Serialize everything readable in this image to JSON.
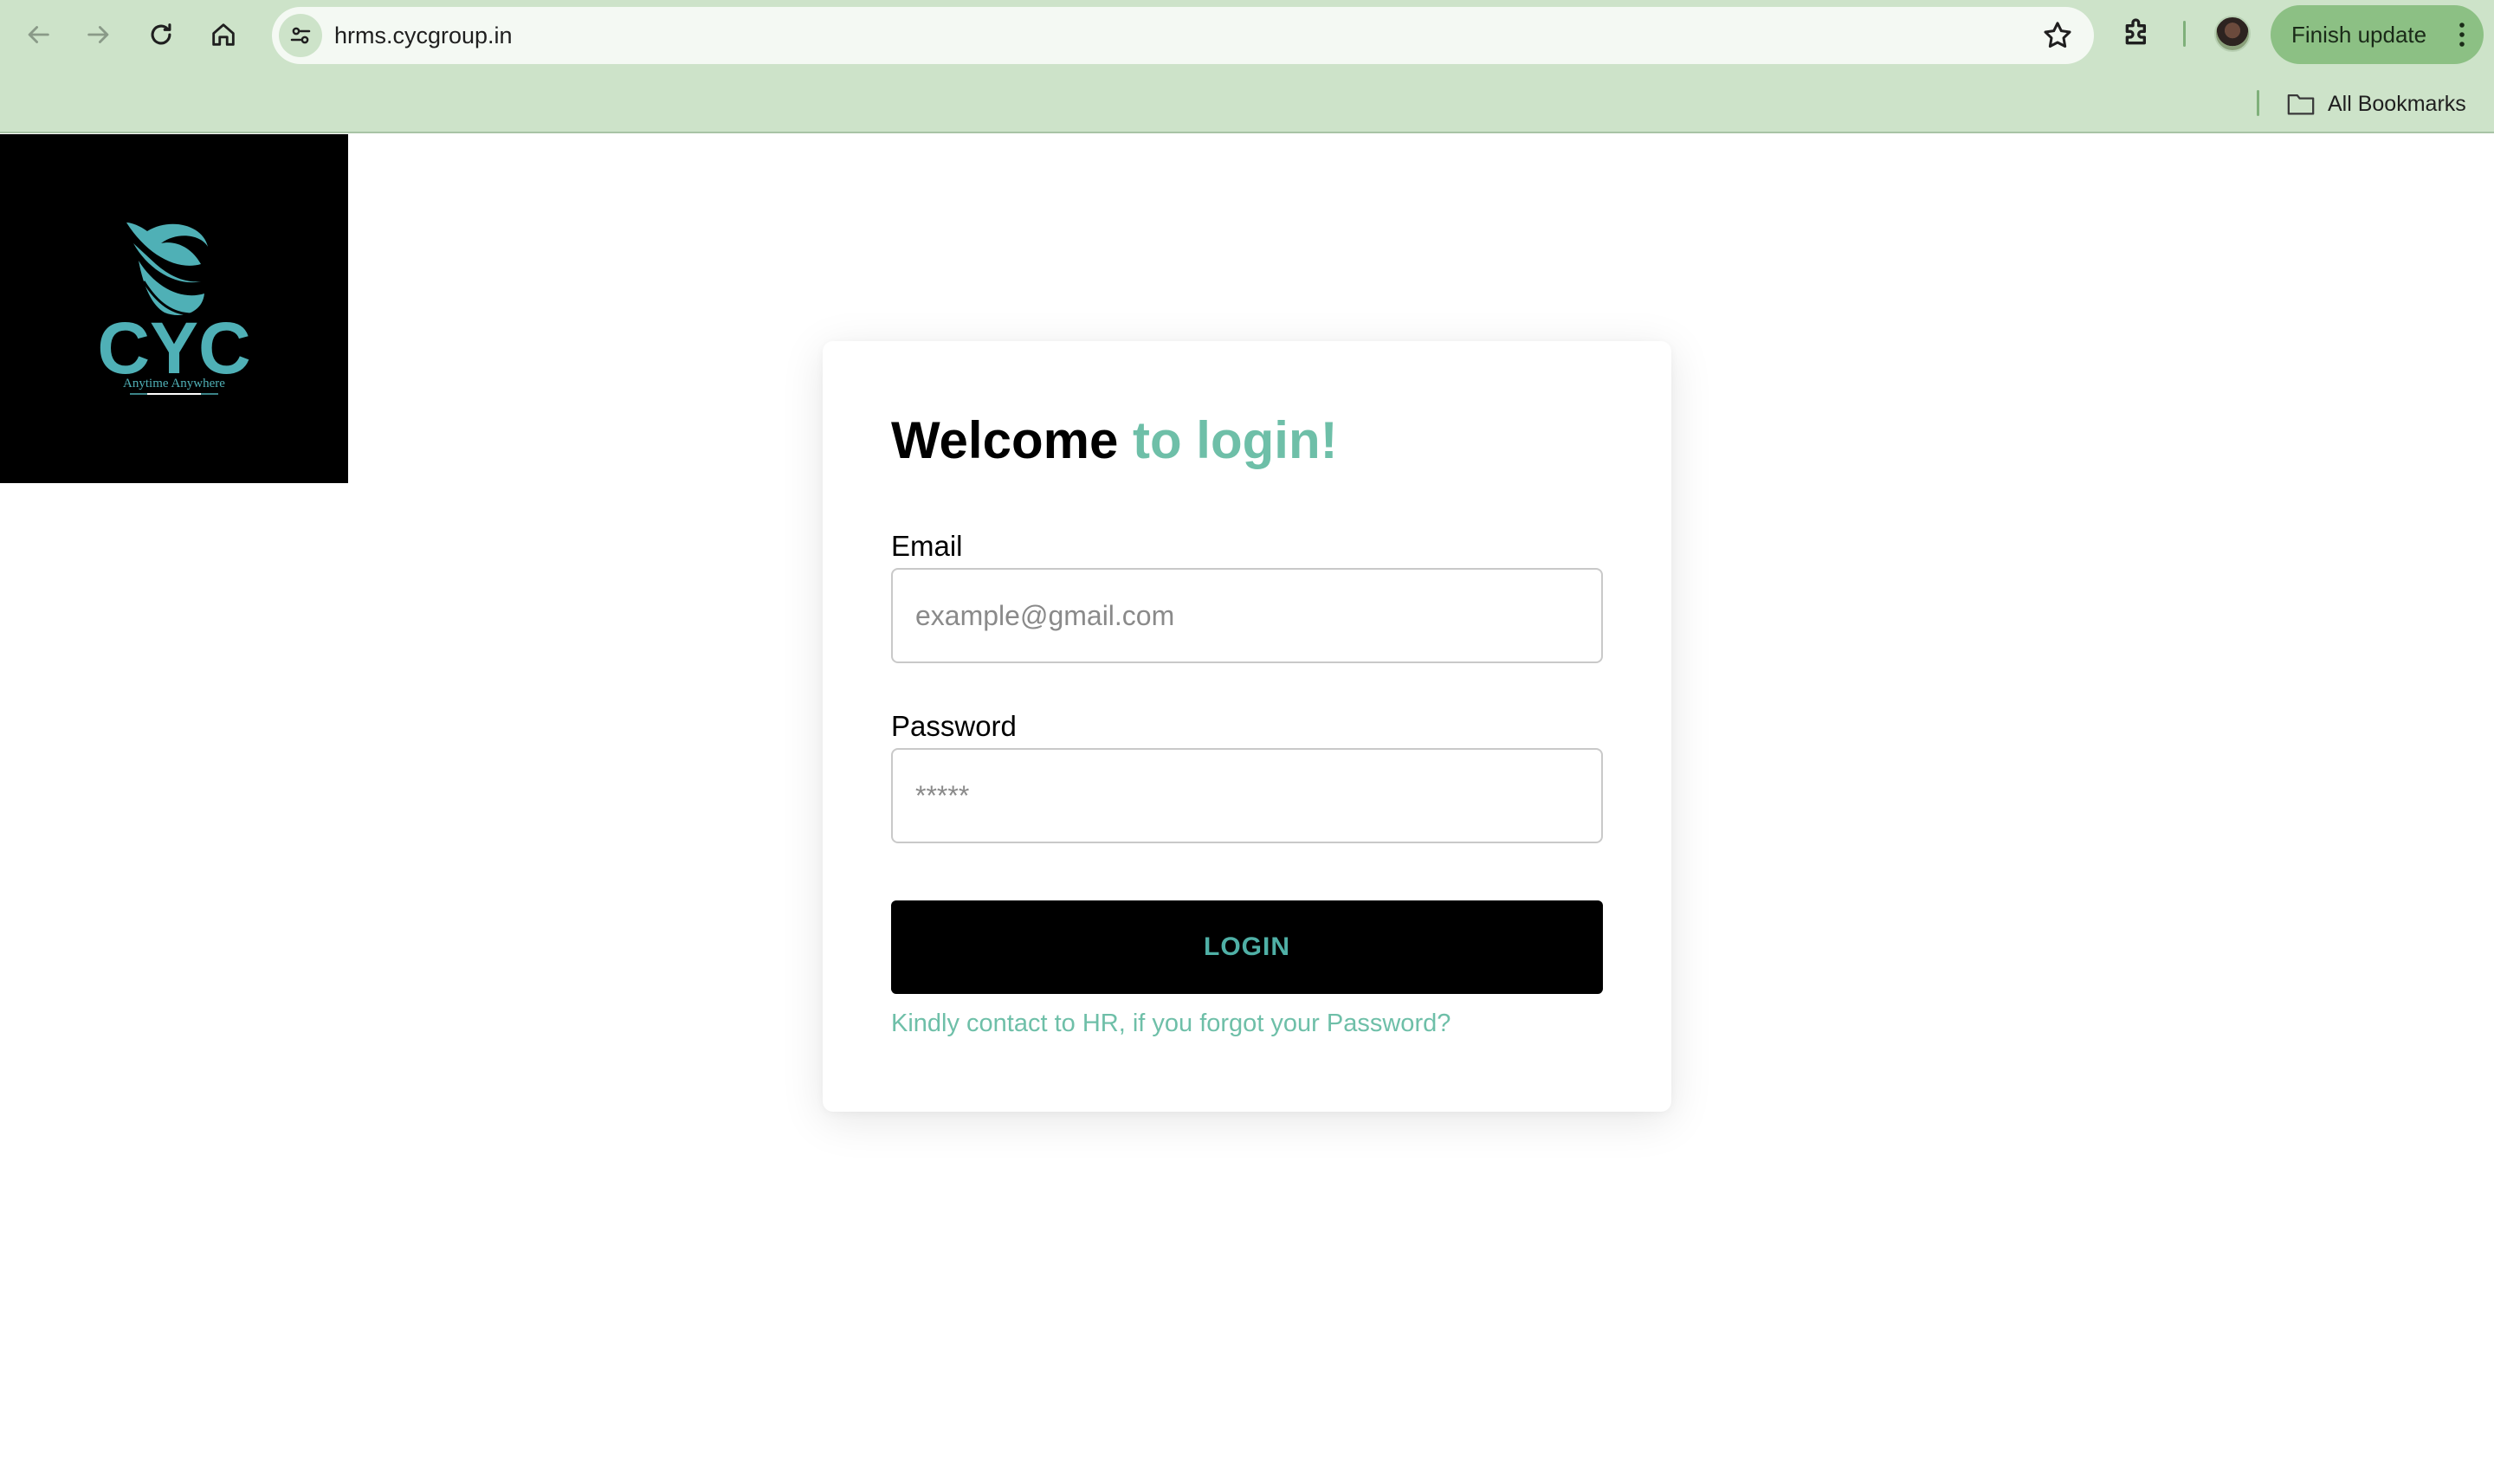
{
  "browser": {
    "url": "hrms.cycgroup.in",
    "update_button_label": "Finish update",
    "bookmarks_label": "All Bookmarks"
  },
  "logo": {
    "text": "CYC",
    "tagline": "Anytime Anywhere",
    "color": "#4fb0b6"
  },
  "login": {
    "title_main": "Welcome",
    "title_accent": "to login!",
    "email_label": "Email",
    "email_placeholder": "example@gmail.com",
    "email_value": "",
    "password_label": "Password",
    "password_placeholder": "*****",
    "password_value": "",
    "login_button": "LOGIN",
    "forgot_text": "Kindly contact to HR, if you forgot your Password?"
  },
  "colors": {
    "accent": "#6ebfa8",
    "button_bg": "#000000",
    "button_text": "#4fb0a6",
    "chrome_bg": "#cde3c9"
  }
}
